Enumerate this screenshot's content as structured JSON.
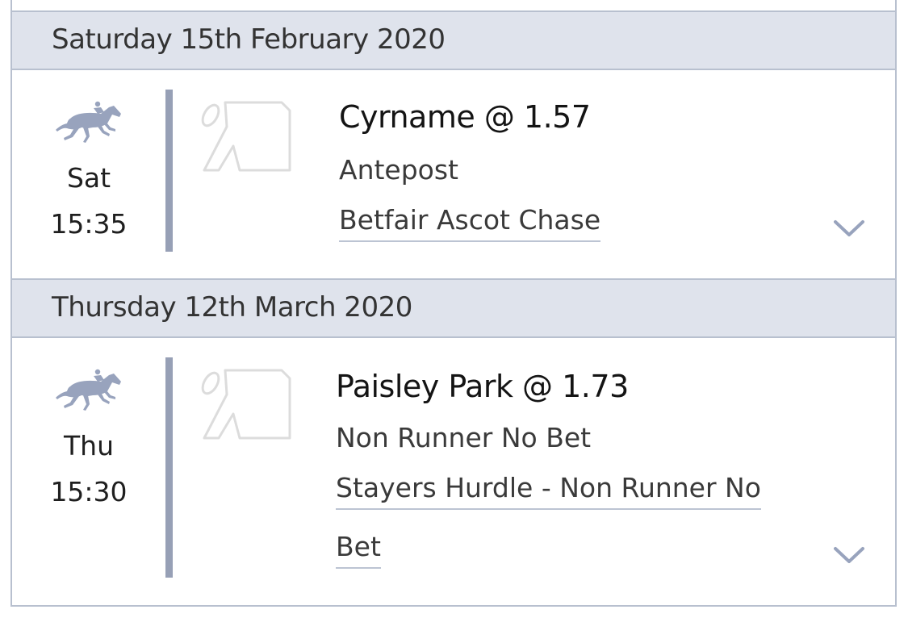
{
  "bets": [
    {
      "date_header": "Saturday 15th February 2020",
      "day": "Sat",
      "time": "15:35",
      "sport_icon": "horse-racing-icon",
      "silks_icon": "jockey-silks-icon",
      "runner": "Cyrname @ 1.57",
      "bet_type": "Antepost",
      "event_line1": "Betfair Ascot Chase",
      "event_line2": "",
      "expand_icon": "chevron-down-icon"
    },
    {
      "date_header": "Thursday 12th March 2020",
      "day": "Thu",
      "time": "15:30",
      "sport_icon": "horse-racing-icon",
      "silks_icon": "jockey-silks-icon",
      "runner": "Paisley Park @ 1.73",
      "bet_type": "Non Runner No Bet",
      "event_line1": "Stayers Hurdle - Non Runner No",
      "event_line2": "Bet",
      "expand_icon": "chevron-down-icon"
    }
  ],
  "colors": {
    "header_bg": "#dfe3ec",
    "border": "#b8c0cf",
    "accent_bar": "#97a0b6",
    "icon": "#98a3bd"
  }
}
